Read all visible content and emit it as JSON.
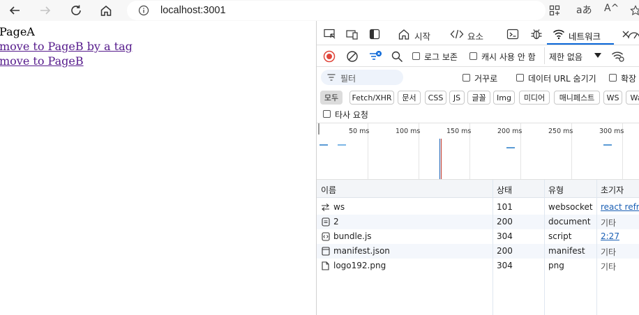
{
  "browser": {
    "url": "localhost:3001",
    "right_icons": [
      "apps-icon",
      "read-aloud-icon",
      "text-size-icon",
      "favorite-icon"
    ],
    "read_aloud_glyph": "aあ",
    "text_size_glyph": "A^"
  },
  "page": {
    "title": "PageA",
    "link_a_tag": "move to PageB by a tag",
    "link_programmatic": "move to PageB"
  },
  "devtools": {
    "tabs": {
      "welcome_label": "시작",
      "elements_label": "요소",
      "network_label": "네트워크"
    },
    "toolbar": {
      "preserve_log": "로그 보존",
      "disable_cache": "캐시 사용 안 함",
      "throttling": "제한 없음"
    },
    "filter": {
      "placeholder": "필터",
      "invert": "거꾸로",
      "hide_data_urls": "데이터 URL 숨기기",
      "extension_partial": "확장"
    },
    "type_filters": [
      "모두",
      "Fetch/XHR",
      "문서",
      "CSS",
      "JS",
      "글꼴",
      "Img",
      "미디어",
      "매니페스트",
      "WS",
      "Wa"
    ],
    "third_party": "타사 요청",
    "timeline_ticks": [
      "50 ms",
      "100 ms",
      "150 ms",
      "200 ms",
      "250 ms",
      "300 ms"
    ],
    "table": {
      "headers": [
        "이름",
        "상태",
        "유형",
        "초기자"
      ],
      "rows": [
        {
          "name": "ws",
          "status": "101",
          "type": "websocket",
          "initiator": "react refres",
          "initiator_link": true,
          "icon": "websocket-icon"
        },
        {
          "name": "2",
          "status": "200",
          "type": "document",
          "initiator": "기타",
          "initiator_link": false,
          "icon": "document-icon"
        },
        {
          "name": "bundle.js",
          "status": "304",
          "type": "script",
          "initiator": "2:27",
          "initiator_link": true,
          "icon": "script-icon"
        },
        {
          "name": "manifest.json",
          "status": "200",
          "type": "manifest",
          "initiator": "기타",
          "initiator_link": false,
          "icon": "manifest-icon"
        },
        {
          "name": "logo192.png",
          "status": "304",
          "type": "png",
          "initiator": "기타",
          "initiator_link": false,
          "icon": "image-icon"
        }
      ]
    }
  },
  "colors": {
    "link_visited": "#551a8b",
    "accent": "#0a67d8",
    "record": "#e0463b"
  }
}
